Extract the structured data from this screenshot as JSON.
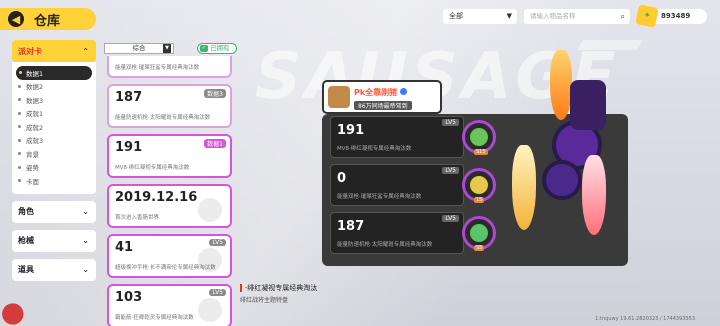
{
  "header": {
    "title": "仓库",
    "back_icon": "back-arrow-icon",
    "filter_select": "全部",
    "search_placeholder": "请输入物品名称",
    "coin_value": "893489"
  },
  "sidebar": {
    "categories": [
      {
        "label": "派对卡",
        "active": true,
        "expanded": true
      },
      {
        "label": "角色",
        "active": false
      },
      {
        "label": "枪械",
        "active": false
      },
      {
        "label": "道具",
        "active": false
      }
    ],
    "subitems": [
      "数据1",
      "数据2",
      "数据3",
      "成就1",
      "成就2",
      "成就3",
      "背景",
      "姿势",
      "卡面"
    ],
    "active_sub": "数据1"
  },
  "filter": {
    "sort_select": "综合",
    "owned_label": "已拥有"
  },
  "cards": [
    {
      "value": "",
      "desc": "能量双枪·璀璨狂鲨专属经典淘汰数",
      "lv": "",
      "partial": true
    },
    {
      "value": "187",
      "desc": "能量防速机枪·太阳耀斑专属经典淘汰数",
      "lv": "数据3"
    },
    {
      "value": "191",
      "desc": "MV8·绯红凝视专属经典淘汰数",
      "lv": "数据1"
    },
    {
      "value": "2019.12.16",
      "desc": "首次进入香肠世界",
      "lv": ""
    },
    {
      "value": "41",
      "desc": "超级换冲手枪·长不满帝伦专属经典淘汰数",
      "lv": "LV5"
    },
    {
      "value": "103",
      "desc": "霸能箭·狂卿乾灵专属经典淘汰数",
      "lv": "LV5"
    }
  ],
  "namecard": {
    "player_name": "Pk全靠刚猪",
    "player_title": "86万同场最帝驾到",
    "entries": [
      {
        "value": "191",
        "lv": "LV5",
        "desc": "MV8·绯红凝视专属经典淘汰数"
      },
      {
        "value": "0",
        "lv": "LV5",
        "desc": "能量双枪·璀璨狂鲨专属经典淘汰数"
      },
      {
        "value": "187",
        "lv": "LV5",
        "desc": "能量防速机枪·太阳耀斑专属经典淘汰数"
      }
    ],
    "medals": [
      "S15",
      "15",
      "S5"
    ]
  },
  "selected": {
    "caption": "·绯红凝视专属经典淘汰",
    "subcaption": "绯红战将主题特盘"
  },
  "watermark": "1:tnquwy 19.61.2820323 / 1744393553",
  "colors": {
    "accent_yellow": "#ffd23a",
    "accent_red": "#d83a22",
    "card_border": "#d655d8",
    "owned_green": "#3bb86a"
  }
}
